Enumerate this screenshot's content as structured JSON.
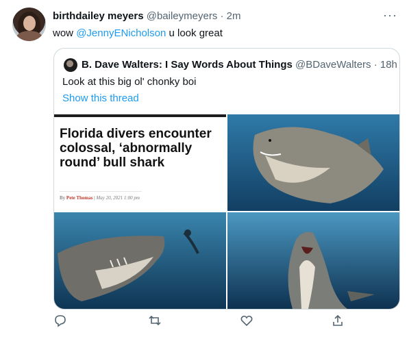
{
  "tweet": {
    "author_name": "birthdailey meyers",
    "author_handle": "@baileymeyers",
    "separator": "·",
    "time": "2m",
    "more": "···",
    "text_prefix": "wow ",
    "mention": "@JennyENicholson",
    "text_suffix": " u look great"
  },
  "quote": {
    "author_name": "B. Dave Walters: I Say Words About Things",
    "author_handle": "@BDaveWalters",
    "separator": "·",
    "time": "18h",
    "text": "Look at this big ol' chonky boi",
    "show_thread": "Show this thread",
    "article": {
      "headline": "Florida divers encounter colossal, ‘abnormally round’ bull shark",
      "byline_prefix": "By ",
      "author": "Pete Thomas",
      "divider": " | ",
      "date": "May 20, 2021 1:00 pm"
    }
  },
  "actions": [
    "reply-icon",
    "retweet-icon",
    "like-icon",
    "share-icon"
  ],
  "colors": {
    "accent": "#1d9bf0",
    "secondary_text": "#536471",
    "border": "#cfd9de",
    "ocean": "#1f5f86"
  }
}
